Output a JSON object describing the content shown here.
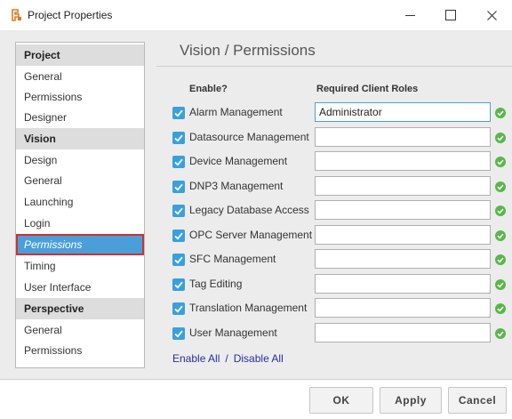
{
  "window": {
    "title": "Project Properties",
    "app_icon": "project-properties-icon",
    "controls": [
      "minimize",
      "maximize",
      "close"
    ]
  },
  "sidebar": {
    "items": [
      {
        "label": "Project",
        "type": "header"
      },
      {
        "label": "General",
        "type": "item"
      },
      {
        "label": "Permissions",
        "type": "item"
      },
      {
        "label": "Designer",
        "type": "item"
      },
      {
        "label": "Vision",
        "type": "header"
      },
      {
        "label": "Design",
        "type": "item"
      },
      {
        "label": "General",
        "type": "item"
      },
      {
        "label": "Launching",
        "type": "item"
      },
      {
        "label": "Login",
        "type": "item"
      },
      {
        "label": "Permissions",
        "type": "item",
        "selected": true
      },
      {
        "label": "Timing",
        "type": "item"
      },
      {
        "label": "User Interface",
        "type": "item"
      },
      {
        "label": "Perspective",
        "type": "header"
      },
      {
        "label": "General",
        "type": "item"
      },
      {
        "label": "Permissions",
        "type": "item"
      }
    ]
  },
  "main": {
    "title": "Vision / Permissions",
    "enable_header": "Enable?",
    "roles_header": "Required Client Roles",
    "rows": [
      {
        "label": "Alarm Management",
        "enabled": true,
        "roles": "Administrator",
        "status": "valid"
      },
      {
        "label": "Datasource Management",
        "enabled": true,
        "roles": "",
        "status": "valid"
      },
      {
        "label": "Device Management",
        "enabled": true,
        "roles": "",
        "status": "valid"
      },
      {
        "label": "DNP3 Management",
        "enabled": true,
        "roles": "",
        "status": "valid"
      },
      {
        "label": "Legacy Database Access",
        "enabled": true,
        "roles": "",
        "status": "valid"
      },
      {
        "label": "OPC Server Management",
        "enabled": true,
        "roles": "",
        "status": "valid"
      },
      {
        "label": "SFC Management",
        "enabled": true,
        "roles": "",
        "status": "valid"
      },
      {
        "label": "Tag Editing",
        "enabled": true,
        "roles": "",
        "status": "valid"
      },
      {
        "label": "Translation Management",
        "enabled": true,
        "roles": "",
        "status": "valid"
      },
      {
        "label": "User Management",
        "enabled": true,
        "roles": "",
        "status": "valid"
      }
    ],
    "enable_all": "Enable All",
    "separator": "/",
    "disable_all": "Disable All"
  },
  "footer": {
    "ok": "OK",
    "apply": "Apply",
    "cancel": "Cancel"
  },
  "colors": {
    "accent": "#4a9fd9",
    "checkbox": "#3aa0dd",
    "valid": "#57b848",
    "selection_outline": "#d32f2f",
    "link": "#2a2aa8"
  }
}
